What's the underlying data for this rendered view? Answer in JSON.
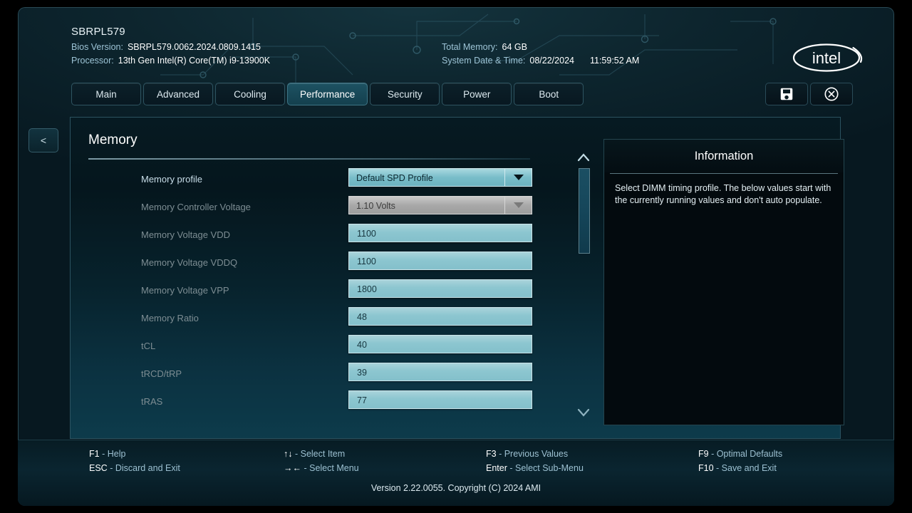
{
  "header": {
    "system_title": "SBRPL579",
    "bios_version_label": "Bios Version:",
    "bios_version_value": "SBRPL579.0062.2024.0809.1415",
    "processor_label": "Processor:",
    "processor_value": "13th Gen Intel(R) Core(TM) i9-13900K",
    "total_memory_label": "Total Memory:",
    "total_memory_value": "64 GB",
    "datetime_label": "System Date & Time:",
    "date_value": "08/22/2024",
    "time_value": "11:59:52 AM",
    "logo_text": "intel"
  },
  "tabs": [
    {
      "label": "Main",
      "active": false
    },
    {
      "label": "Advanced",
      "active": false
    },
    {
      "label": "Cooling",
      "active": false
    },
    {
      "label": "Performance",
      "active": true
    },
    {
      "label": "Security",
      "active": false
    },
    {
      "label": "Power",
      "active": false
    },
    {
      "label": "Boot",
      "active": false
    }
  ],
  "toolbar": {
    "save_icon": "floppy-disk-icon",
    "close_icon": "close-circle-icon"
  },
  "back_button": {
    "label": "<"
  },
  "main": {
    "section_title": "Memory",
    "fields": [
      {
        "label": "Memory profile",
        "value": "Default SPD Profile",
        "type": "select",
        "enabled": true
      },
      {
        "label": "Memory Controller Voltage",
        "value": "1.10 Volts",
        "type": "select",
        "enabled": false
      },
      {
        "label": "Memory Voltage VDD",
        "value": "1100",
        "type": "text",
        "enabled": true
      },
      {
        "label": "Memory Voltage VDDQ",
        "value": "1100",
        "type": "text",
        "enabled": true
      },
      {
        "label": "Memory Voltage VPP",
        "value": "1800",
        "type": "text",
        "enabled": true
      },
      {
        "label": "Memory Ratio",
        "value": "48",
        "type": "text",
        "enabled": true
      },
      {
        "label": "tCL",
        "value": "40",
        "type": "text",
        "enabled": true
      },
      {
        "label": "tRCD/tRP",
        "value": "39",
        "type": "text",
        "enabled": true
      },
      {
        "label": "tRAS",
        "value": "77",
        "type": "text",
        "enabled": true
      }
    ]
  },
  "scrollbar": {
    "up_icon": "chevron-up-icon",
    "down_icon": "chevron-down-icon"
  },
  "info": {
    "title": "Information",
    "body": "Select DIMM timing profile. The below values start with the currently running values and don't auto populate."
  },
  "footer": {
    "help": [
      {
        "key": "F1",
        "desc": "- Help"
      },
      {
        "key": "ESC",
        "desc": "- Discard and Exit"
      },
      {
        "key": "↑↓",
        "desc": "- Select Item"
      },
      {
        "key": "→←",
        "desc": "- Select Menu"
      },
      {
        "key": "F3",
        "desc": "- Previous Values"
      },
      {
        "key": "Enter",
        "desc": "- Select Sub-Menu"
      },
      {
        "key": "F9",
        "desc": "- Optimal Defaults"
      },
      {
        "key": "F10",
        "desc": "- Save and Exit"
      }
    ],
    "version": "Version 2.22.0055. Copyright (C) 2024 AMI"
  },
  "colors": {
    "accent_teal": "#1d5262",
    "field_teal": "#8cc6d0",
    "panel_bg": "#061a22",
    "label_muted": "#7d8d93",
    "label_active": "#c8dde8"
  }
}
